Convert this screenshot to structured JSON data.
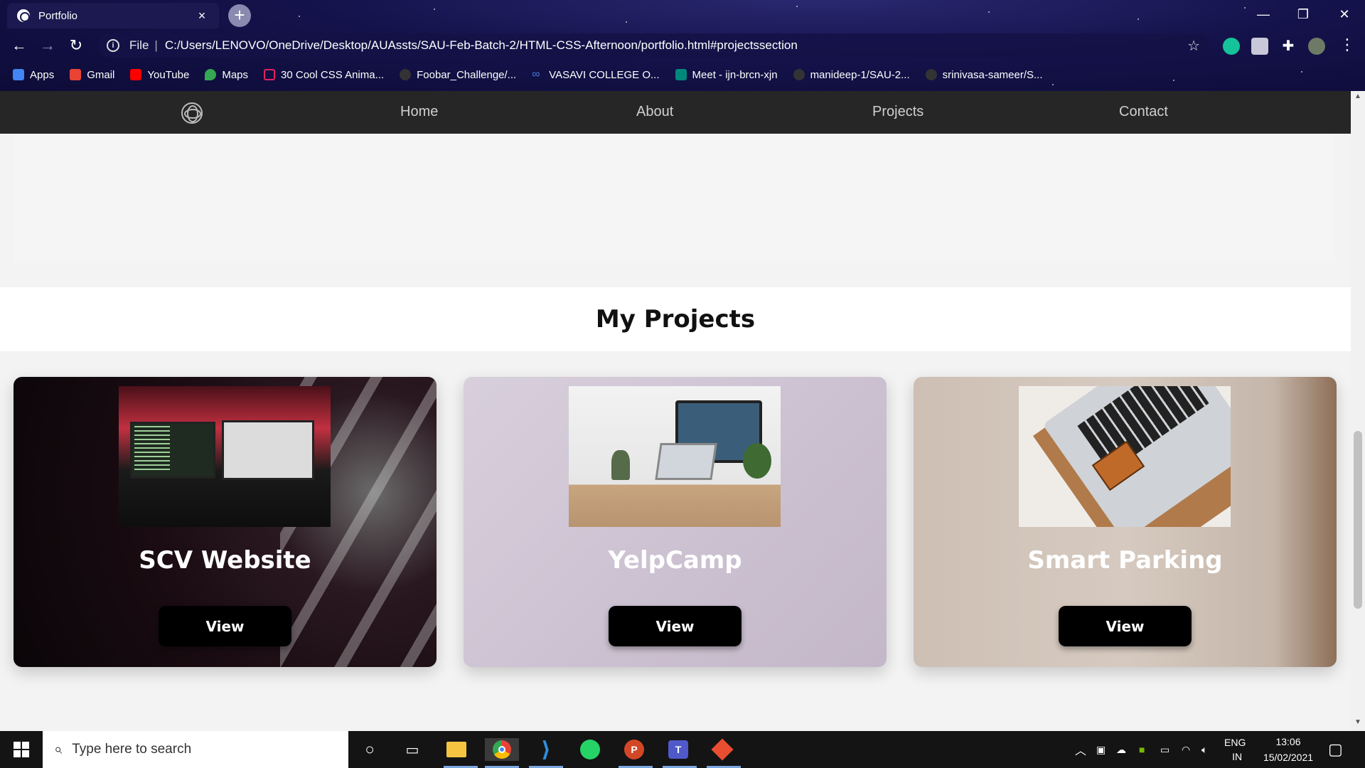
{
  "browser": {
    "tab_title": "Portfolio",
    "tab_close": "×",
    "new_tab": "+",
    "address_scheme": "File",
    "address_url": "C:/Users/LENOVO/OneDrive/Desktop/AUAssts/SAU-Feb-Batch-2/HTML-CSS-Afternoon/portfolio.html#projectssection",
    "bookmarks": [
      {
        "label": "Apps",
        "color": "#4285f4"
      },
      {
        "label": "Gmail",
        "color": "#ea4335"
      },
      {
        "label": "YouTube",
        "color": "#ff0000"
      },
      {
        "label": "Maps",
        "color": "#34a853"
      },
      {
        "label": "30 Cool CSS Anima...",
        "color": "#e0245e"
      },
      {
        "label": "Foobar_Challenge/...",
        "color": "#555555"
      },
      {
        "label": "VASAVI COLLEGE O...",
        "color": "#4a7bd8"
      },
      {
        "label": "Meet - ijn-brcn-xjn",
        "color": "#00897b"
      },
      {
        "label": "manideep-1/SAU-2...",
        "color": "#555555"
      },
      {
        "label": "srinivasa-sameer/S...",
        "color": "#555555"
      }
    ]
  },
  "site": {
    "nav": [
      "Home",
      "About",
      "Projects",
      "Contact"
    ],
    "projects_title": "My Projects",
    "projects": [
      {
        "name": "SCV Website",
        "button": "View"
      },
      {
        "name": "YelpCamp",
        "button": "View"
      },
      {
        "name": "Smart Parking",
        "button": "View"
      }
    ]
  },
  "taskbar": {
    "search_placeholder": "Type here to search",
    "lang_top": "ENG",
    "lang_bottom": "IN",
    "time": "13:06",
    "date": "15/02/2021"
  }
}
